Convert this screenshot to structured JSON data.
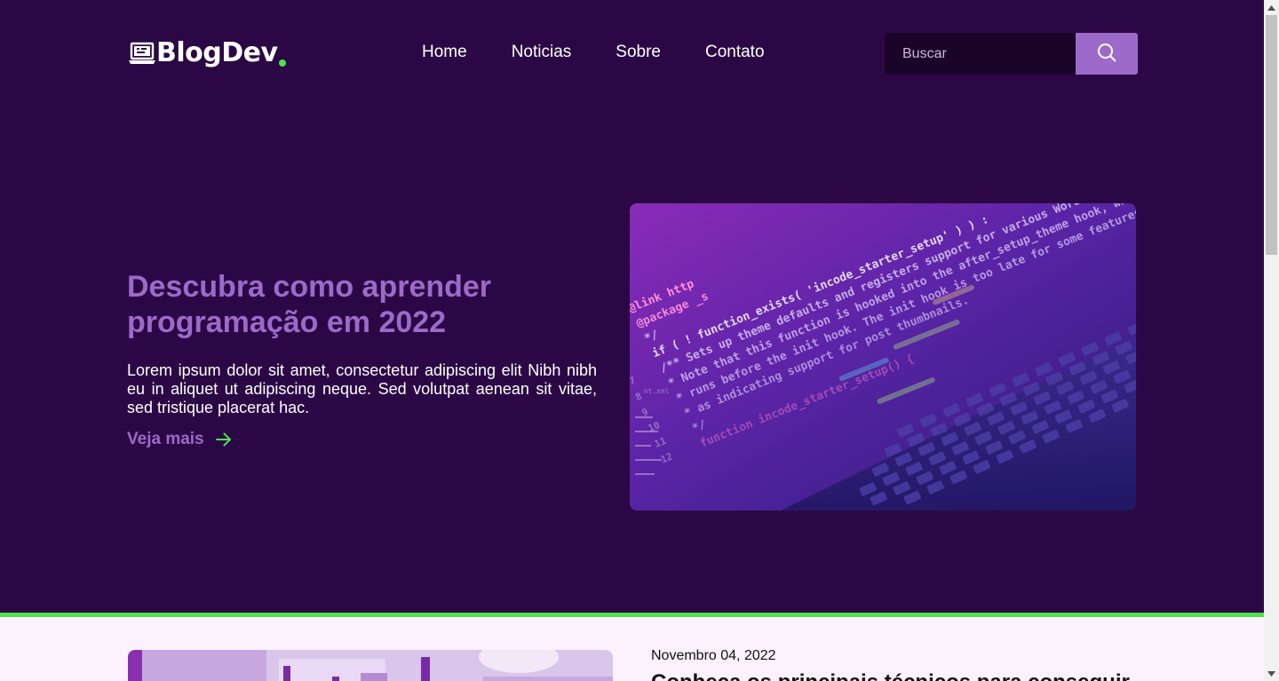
{
  "brand": {
    "name": "BlogDev",
    "accent": "#4ce34c",
    "lilac": "#9c6ac9",
    "background": "#2b0845"
  },
  "nav": {
    "items": [
      {
        "label": "Home"
      },
      {
        "label": "Noticias"
      },
      {
        "label": "Sobre"
      },
      {
        "label": "Contato"
      }
    ]
  },
  "search": {
    "placeholder": "Buscar",
    "icon": "search-icon"
  },
  "hero": {
    "title": "Descubra como aprender programação em 2022",
    "description": "Lorem ipsum dolor sit amet, consectetur adipiscing elit Nibh nibh eu in aliquet ut adipiscing neque. Sed volutpat aenean sit vitae, sed tristique placerat hac.",
    "link_label": "Veja mais",
    "link_icon": "arrow-right-icon",
    "image": "code-on-laptop-image",
    "code_lines": [
      "@link http",
      "@package _s",
      "*/",
      "if ( ! function_exists( 'incode_starter_setup' ) ) :",
      "/** Sets up theme defaults and registers support for various WordPress features.",
      " * Note that this function is hooked into the after_setup_theme hook, which",
      " * runs before the init hook. The init hook is too late for some features, such",
      " * as indicating support for post thumbnails.",
      " */",
      "function incode_starter_setup() {"
    ]
  },
  "latest_post": {
    "date": "Novembro 04, 2022",
    "title": "Conheça os principais técnicos para conseguir",
    "image": "office-image"
  }
}
